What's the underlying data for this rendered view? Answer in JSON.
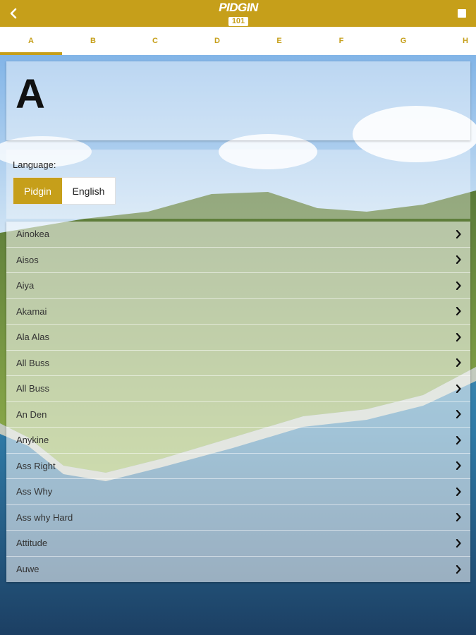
{
  "app": {
    "logo_word": "PIDGIN",
    "logo_number": "101",
    "brand_color": "#c69f1a"
  },
  "tabs": [
    {
      "label": "A",
      "active": true
    },
    {
      "label": "B"
    },
    {
      "label": "C"
    },
    {
      "label": "D"
    },
    {
      "label": "E"
    },
    {
      "label": "F"
    },
    {
      "label": "G"
    },
    {
      "label": "H"
    }
  ],
  "header": {
    "letter": "A"
  },
  "language": {
    "label": "Language:",
    "options": [
      "Pidgin",
      "English"
    ],
    "selected": "Pidgin"
  },
  "words": [
    {
      "label": "Ainokea"
    },
    {
      "label": "Aisos"
    },
    {
      "label": "Aiya"
    },
    {
      "label": "Akamai"
    },
    {
      "label": "Ala Alas"
    },
    {
      "label": "All Buss"
    },
    {
      "label": "All Buss"
    },
    {
      "label": "An Den"
    },
    {
      "label": "Anykine"
    },
    {
      "label": "Ass Right"
    },
    {
      "label": "Ass Why"
    },
    {
      "label": "Ass why Hard"
    },
    {
      "label": "Attitude"
    },
    {
      "label": "Auwe"
    }
  ],
  "icons": {
    "back": "chevron-left-icon",
    "menu": "menu-icon",
    "row": "chevron-right-icon"
  }
}
